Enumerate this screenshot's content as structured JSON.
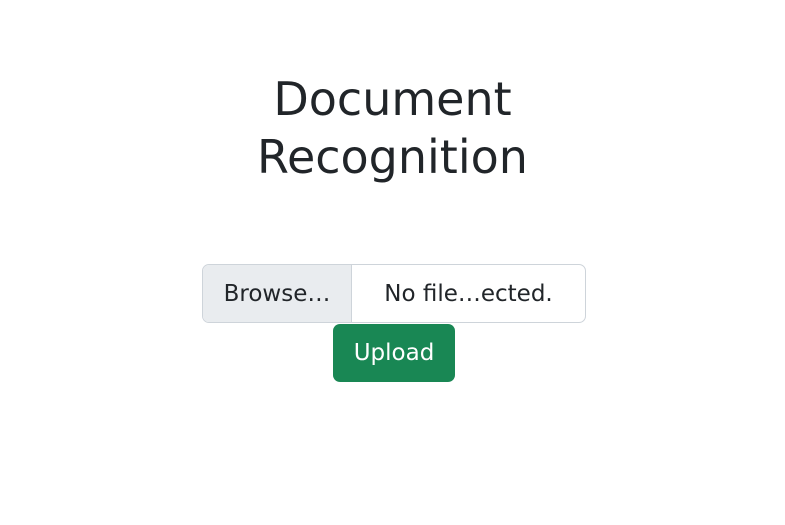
{
  "page": {
    "title_line1": "Document",
    "title_line2": "Recognition"
  },
  "file_input": {
    "browse_label": "Browse…",
    "file_name": "No file…ected."
  },
  "upload_button": {
    "label": "Upload"
  },
  "colors": {
    "upload_button": "#198754",
    "browse_background": "#e9ecef",
    "border": "#ced4da",
    "text": "#212529"
  }
}
